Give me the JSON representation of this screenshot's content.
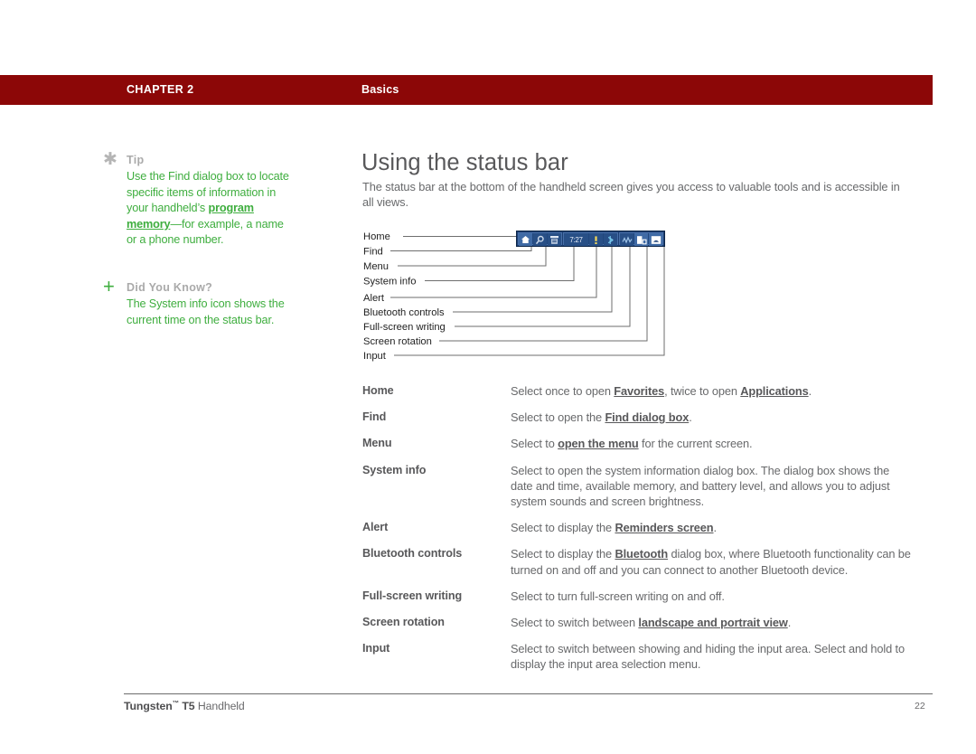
{
  "header": {
    "chapter": "CHAPTER 2",
    "section": "Basics",
    "band_color": "#8c0707"
  },
  "sidebar": {
    "notes": [
      {
        "icon": "asterisk-icon",
        "title": "Tip",
        "body_pre": "Use the Find dialog box to locate specific items of information in your handheld’s ",
        "body_link": "program memory",
        "body_post": "—for example, a name or a phone number.",
        "text_color": "#3fae3f"
      },
      {
        "icon": "plus-icon",
        "title": "Did You Know?",
        "body_pre": "The System info icon shows the current time on the status bar.",
        "body_link": "",
        "body_post": "",
        "text_color": "#3fae3f"
      }
    ]
  },
  "main": {
    "title": "Using the status bar",
    "intro": "The status bar at the bottom of the handheld screen gives you access to valuable tools and is accessible in all views."
  },
  "diagram": {
    "name": "status-bar-callout-diagram",
    "callout_labels": [
      "Home",
      "Find",
      "Menu",
      "System info",
      "Alert",
      "Bluetooth controls",
      "Full-screen writing",
      "Screen rotation",
      "Input"
    ],
    "statusbar": {
      "time_value": "7:27",
      "groups": [
        {
          "icons": [
            "home-icon",
            "find-magnifier-icon",
            "menu-list-icon"
          ]
        },
        {
          "icons": [
            "system-info-time",
            "alert-bell-icon",
            "bluetooth-icon"
          ]
        },
        {
          "icons": [
            "full-screen-writing-icon",
            "screen-rotation-icon",
            "input-area-icon"
          ]
        }
      ],
      "bar_color": "#1d3f73",
      "cell_color": "#284f86"
    }
  },
  "definitions": {
    "rows": [
      {
        "term": "Home",
        "parts": [
          {
            "t": "Select once to open "
          },
          {
            "t": "Favorites",
            "link": true
          },
          {
            "t": ", twice to open "
          },
          {
            "t": "Applications",
            "link": true
          },
          {
            "t": "."
          }
        ]
      },
      {
        "term": "Find",
        "parts": [
          {
            "t": "Select to open the "
          },
          {
            "t": "Find dialog box",
            "link": true
          },
          {
            "t": "."
          }
        ]
      },
      {
        "term": "Menu",
        "parts": [
          {
            "t": "Select to "
          },
          {
            "t": "open the menu",
            "link": true
          },
          {
            "t": " for the current screen."
          }
        ]
      },
      {
        "term": "System info",
        "parts": [
          {
            "t": "Select to open the system information dialog box. The dialog box shows the date and time, available memory, and battery level, and allows you to adjust system sounds and screen brightness."
          }
        ]
      },
      {
        "term": "Alert",
        "parts": [
          {
            "t": "Select to display the "
          },
          {
            "t": "Reminders screen",
            "link": true
          },
          {
            "t": "."
          }
        ]
      },
      {
        "term": "Bluetooth controls",
        "parts": [
          {
            "t": "Select to display the "
          },
          {
            "t": "Bluetooth",
            "link": true
          },
          {
            "t": " dialog box, where Bluetooth functionality can be turned on and off and you can connect to another Bluetooth device."
          }
        ]
      },
      {
        "term": "Full-screen writing",
        "parts": [
          {
            "t": "Select to turn full-screen writing on and off."
          }
        ]
      },
      {
        "term": "Screen rotation",
        "parts": [
          {
            "t": "Select to switch between "
          },
          {
            "t": "landscape and portrait view",
            "link": true
          },
          {
            "t": "."
          }
        ]
      },
      {
        "term": "Input",
        "parts": [
          {
            "t": "Select to switch between showing and hiding the input area. Select and hold to display the input area selection menu."
          }
        ]
      }
    ]
  },
  "footer": {
    "product_bold": "Tungsten",
    "trademark": "™",
    "product_model": " T5 ",
    "product_rest": "Handheld",
    "page_number": "22"
  }
}
